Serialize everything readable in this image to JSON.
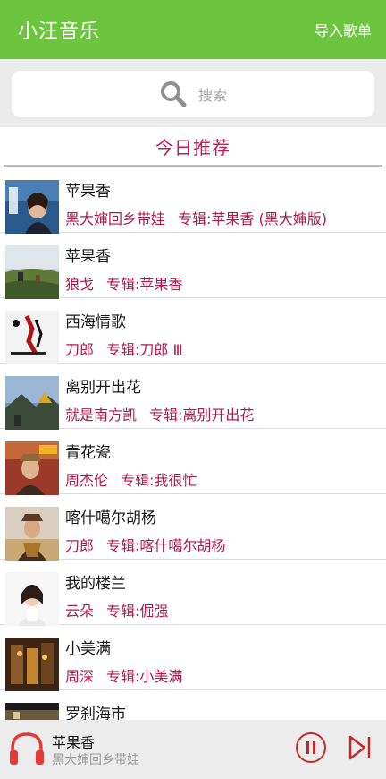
{
  "app_bar": {
    "title": "小汪音乐",
    "import_label": "导入歌单"
  },
  "search": {
    "placeholder": "搜索",
    "icon": "search-icon"
  },
  "section": {
    "title": "今日推荐"
  },
  "songs": [
    {
      "title": "苹果香",
      "artist": "黑大婶回乡带娃",
      "album": "专辑:苹果香 (黑大婶版)"
    },
    {
      "title": "苹果香",
      "artist": "狼戈",
      "album": "专辑:苹果香"
    },
    {
      "title": "西海情歌",
      "artist": "刀郎",
      "album": "专辑:刀郎 Ⅲ"
    },
    {
      "title": "离别开出花",
      "artist": "就是南方凯",
      "album": "专辑:离别开出花"
    },
    {
      "title": "青花瓷",
      "artist": "周杰伦",
      "album": "专辑:我很忙"
    },
    {
      "title": "喀什噶尔胡杨",
      "artist": "刀郎",
      "album": "专辑:喀什噶尔胡杨"
    },
    {
      "title": "我的楼兰",
      "artist": "云朵",
      "album": "专辑:倔强"
    },
    {
      "title": "小美满",
      "artist": "周深",
      "album": "专辑:小美满"
    },
    {
      "title": "罗刹海市",
      "artist": "",
      "album": ""
    }
  ],
  "player": {
    "title": "苹果香",
    "artist": "黑大婶回乡带娃",
    "icons": [
      "headphones-icon",
      "pause-icon",
      "next-icon"
    ]
  },
  "colors": {
    "app_bar": "#6dc43f",
    "accent": "#c2185b",
    "meta_text": "#b0174f",
    "player_icon": "#e53935"
  }
}
